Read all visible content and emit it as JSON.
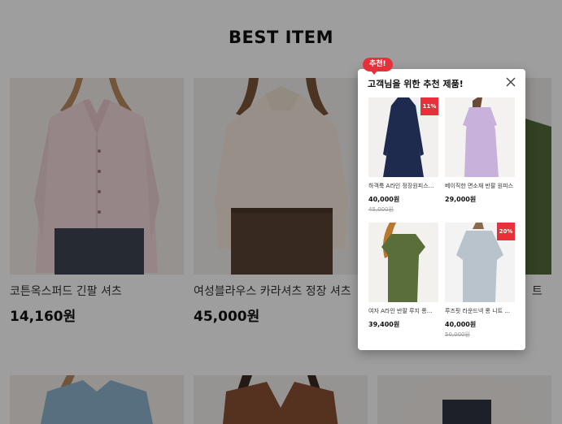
{
  "section_title": "BEST ITEM",
  "products": [
    {
      "name": "코튼옥스퍼드 긴팔 셔츠",
      "price": "14,160원"
    },
    {
      "name": "여성블라우스 카라셔츠 정장 셔츠",
      "price": "45,000원"
    },
    {
      "name_tail": "트"
    }
  ],
  "popup": {
    "badge": "추천!",
    "title": "고객님을 위한 추천 제품!",
    "items": [
      {
        "name": "하객룩 A라인 정장원피스...",
        "price": "40,000원",
        "original_price": "45,000원",
        "discount": "11%"
      },
      {
        "name": "베이직한 면소재 반팔 원피스",
        "price": "29,000원"
      },
      {
        "name": "여자 A라인 반팔 루지 롱...",
        "price": "39,400원"
      },
      {
        "name": "루즈핏 라운드넥 롱 니트 ...",
        "price": "40,000원",
        "original_price": "50,000원",
        "discount": "20%"
      }
    ]
  },
  "icons": {
    "close": "close-icon"
  },
  "colors": {
    "accent": "#e8303a",
    "overlay": "rgba(0,0,0,0.38)"
  }
}
